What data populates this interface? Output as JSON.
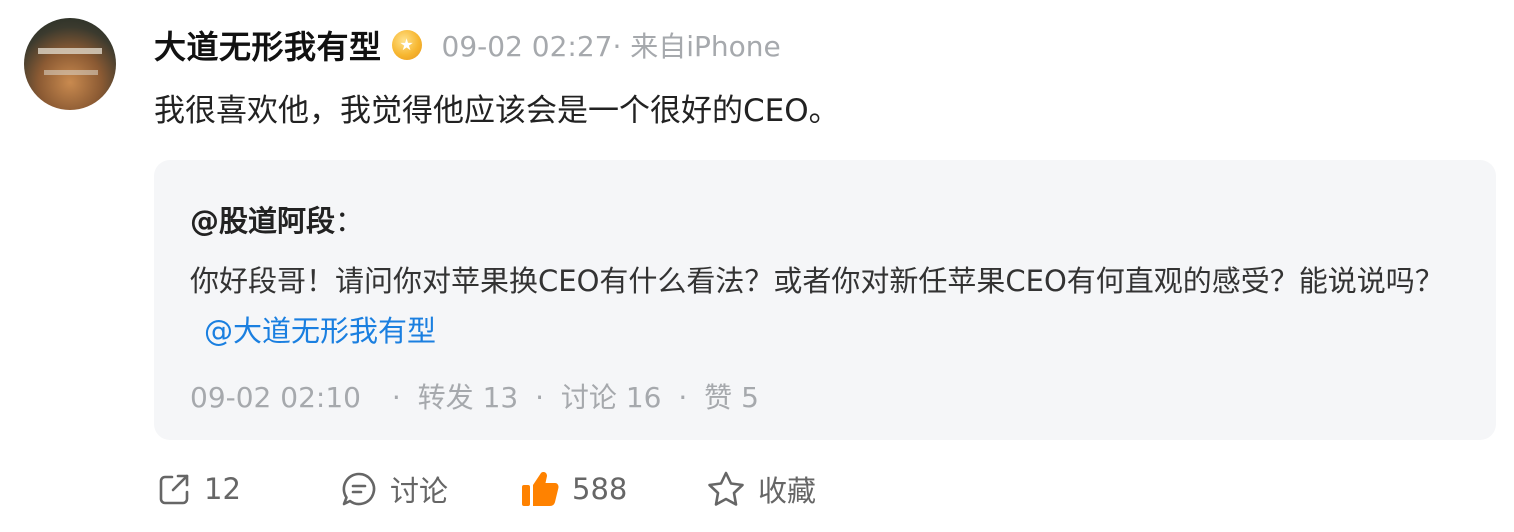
{
  "post": {
    "author": "大道无形我有型",
    "meta": "09-02 02:27· 来自iPhone",
    "text": "我很喜欢他，我觉得他应该会是一个很好的CEO。"
  },
  "repost": {
    "author": "@股道阿段",
    "colon": "：",
    "text": "你好段哥！请问你对苹果换CEO有什么看法？或者你对新任苹果CEO有何直观的感受？能说说吗？",
    "mention": "@大道无形我有型",
    "time": "09-02 02:10",
    "reposts": "转发 13",
    "comments": "讨论 16",
    "likes": "赞 5",
    "separator": "·"
  },
  "actions": {
    "repost_count": "12",
    "comment_label": "讨论",
    "like_count": "588",
    "favorite_label": "收藏"
  },
  "colors": {
    "mention": "#1a7fe0",
    "like_active": "#ff8200",
    "muted": "#a6a9ad"
  },
  "icons": {
    "badge": "vip-badge-icon",
    "repost": "repost-icon",
    "comment": "comment-icon",
    "like": "thumbs-up-icon",
    "favorite": "star-icon"
  }
}
